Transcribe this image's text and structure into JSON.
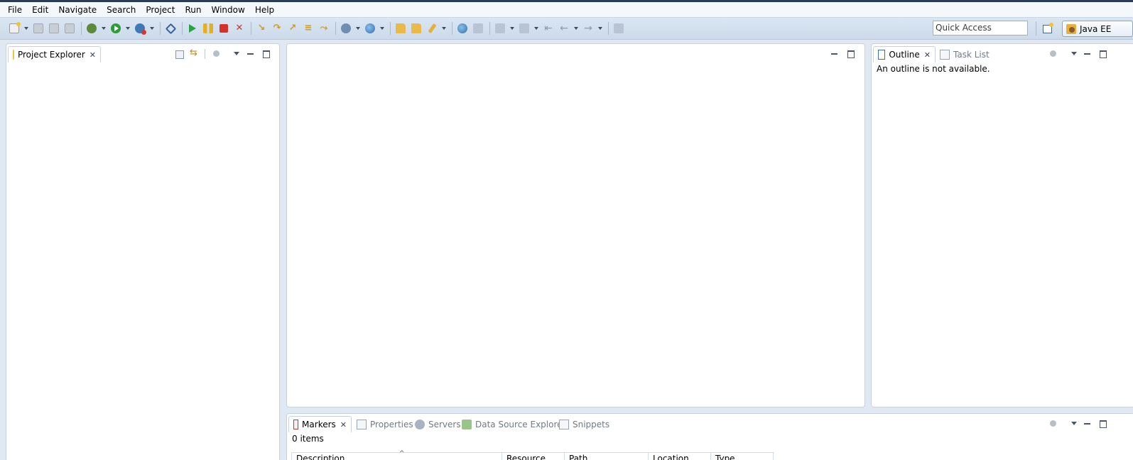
{
  "menu": [
    "File",
    "Edit",
    "Navigate",
    "Search",
    "Project",
    "Run",
    "Window",
    "Help"
  ],
  "quick_access": {
    "placeholder": "Quick Access"
  },
  "perspective": {
    "label": "Java EE"
  },
  "left_view": {
    "tab_label": "Project Explorer"
  },
  "right_view": {
    "tabs": [
      {
        "label": "Outline",
        "active": true
      },
      {
        "label": "Task List",
        "active": false
      }
    ],
    "message": "An outline is not available."
  },
  "bottom_view": {
    "tabs": [
      {
        "label": "Markers",
        "active": true
      },
      {
        "label": "Properties",
        "active": false
      },
      {
        "label": "Servers",
        "active": false
      },
      {
        "label": "Data Source Explorer",
        "active": false
      },
      {
        "label": "Snippets",
        "active": false
      }
    ],
    "count": "0 items",
    "columns": [
      "Description",
      "Resource",
      "Path",
      "Location",
      "Type"
    ]
  },
  "colors": {
    "accent": "#dfe8f3",
    "toolbar": "#ccdaea",
    "run_green": "#2d9b38",
    "stop_red": "#d5302a"
  }
}
